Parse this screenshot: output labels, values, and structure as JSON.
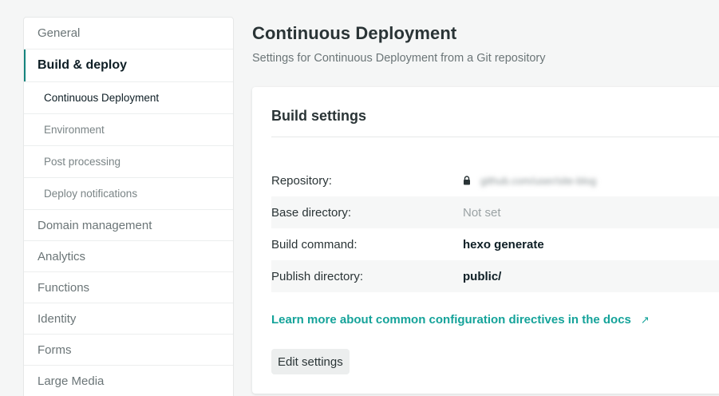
{
  "sidebar": {
    "items": [
      {
        "label": "General"
      },
      {
        "label": "Build & deploy"
      },
      {
        "label": "Continuous Deployment"
      },
      {
        "label": "Environment"
      },
      {
        "label": "Post processing"
      },
      {
        "label": "Deploy notifications"
      },
      {
        "label": "Domain management"
      },
      {
        "label": "Analytics"
      },
      {
        "label": "Functions"
      },
      {
        "label": "Identity"
      },
      {
        "label": "Forms"
      },
      {
        "label": "Large Media"
      }
    ],
    "accent_color": "#15847d"
  },
  "header": {
    "title": "Continuous Deployment",
    "subtitle": "Settings for Continuous Deployment from a Git repository"
  },
  "card": {
    "title": "Build settings",
    "rows": [
      {
        "label": "Repository:",
        "value": "github.com/user/site-blog",
        "icon": "lock-icon"
      },
      {
        "label": "Base directory:",
        "value": "Not set"
      },
      {
        "label": "Build command:",
        "value": "hexo generate"
      },
      {
        "label": "Publish directory:",
        "value": "public/"
      }
    ],
    "docs_link": "Learn more about common configuration directives in the docs",
    "docs_link_icon": "↗",
    "edit_button": "Edit settings",
    "link_color": "#15a39a"
  }
}
